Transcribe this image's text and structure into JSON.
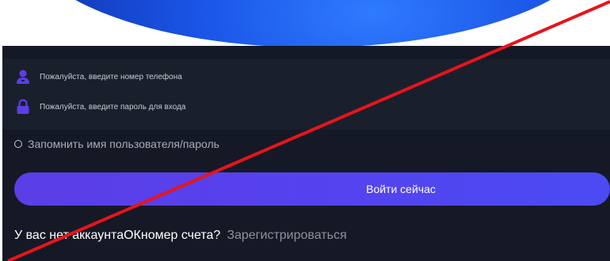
{
  "login": {
    "phone_placeholder": "Пожалуйста, введите номер телефона",
    "password_placeholder": "Пожалуйста, введите пароль для входа",
    "remember_label": "Запомнить имя пользователя/пароль",
    "login_button": "Войти сейчас",
    "no_account_text": "У вас нет аккаунтаОКномер счета?",
    "register_link": "Зарегистрироваться"
  },
  "icons": {
    "phone_field": "user-icon",
    "password_field": "lock-icon",
    "remember": "radio-icon"
  },
  "colors": {
    "panel_bg": "#141925",
    "field_bg": "#1a1f2c",
    "accent": "#5542ee",
    "banner": "#1a55e6",
    "strike_line": "#e8141b"
  }
}
